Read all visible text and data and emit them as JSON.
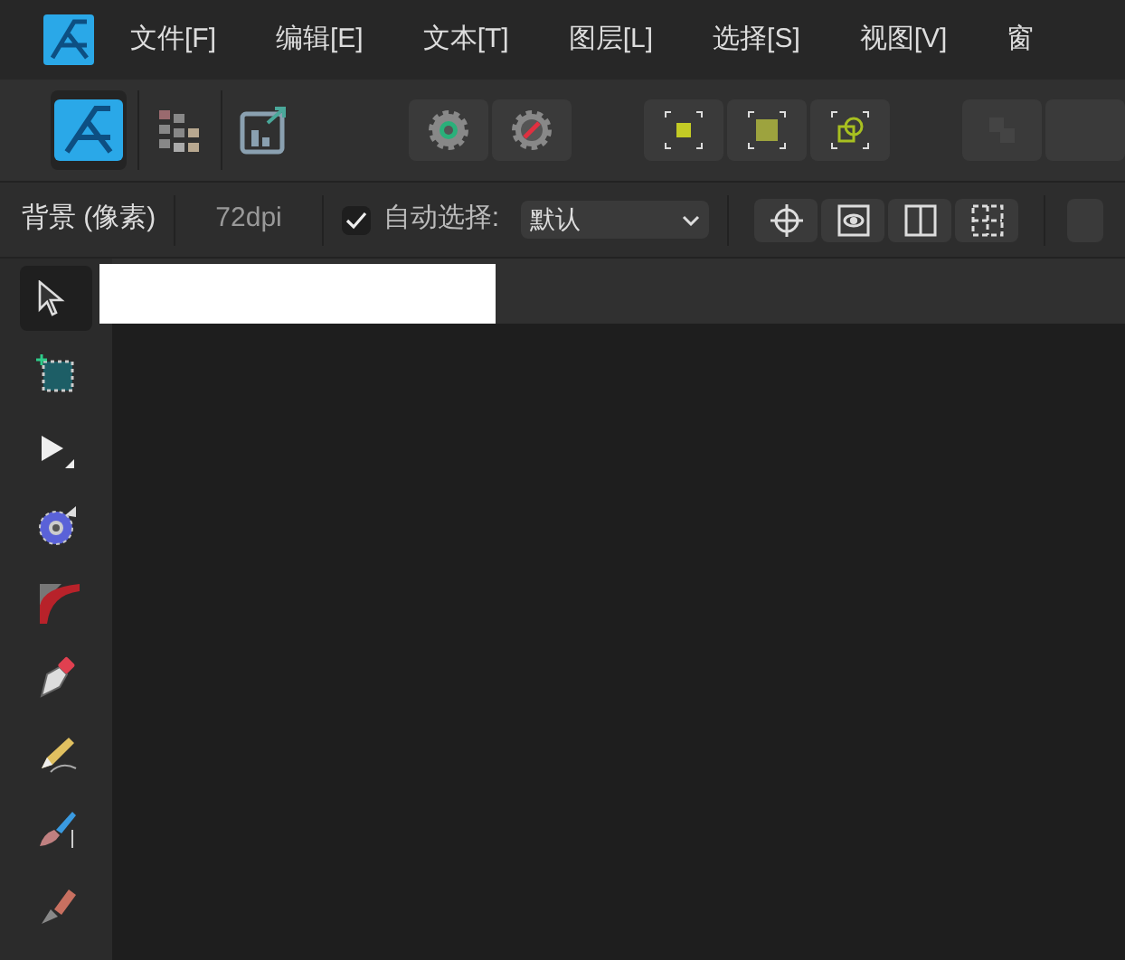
{
  "menu": [
    {
      "label": "文件[F]"
    },
    {
      "label": "编辑[E]"
    },
    {
      "label": "文本[T]"
    },
    {
      "label": "图层[L]"
    },
    {
      "label": "选择[S]"
    },
    {
      "label": "视图[V]"
    },
    {
      "label": "窗"
    }
  ],
  "personas": [
    {
      "kind": "photo",
      "selected": true
    },
    {
      "kind": "pixel",
      "selected": false
    },
    {
      "kind": "export",
      "selected": false
    }
  ],
  "context_bar": {
    "layer": "背景 (像素)",
    "dpi": "72dpi",
    "auto_select": {
      "checked": true,
      "label": "自动选择:"
    },
    "dropdown": {
      "value": "默认"
    }
  },
  "tools": [
    {
      "kind": "move",
      "selected": true
    },
    {
      "kind": "crop",
      "selected": false
    },
    {
      "kind": "node",
      "selected": false
    },
    {
      "kind": "gear",
      "selected": false
    },
    {
      "kind": "corner",
      "selected": false
    },
    {
      "kind": "pen",
      "selected": false
    },
    {
      "kind": "pencil",
      "selected": false
    },
    {
      "kind": "brush",
      "selected": false
    },
    {
      "kind": "fill",
      "selected": false
    }
  ]
}
